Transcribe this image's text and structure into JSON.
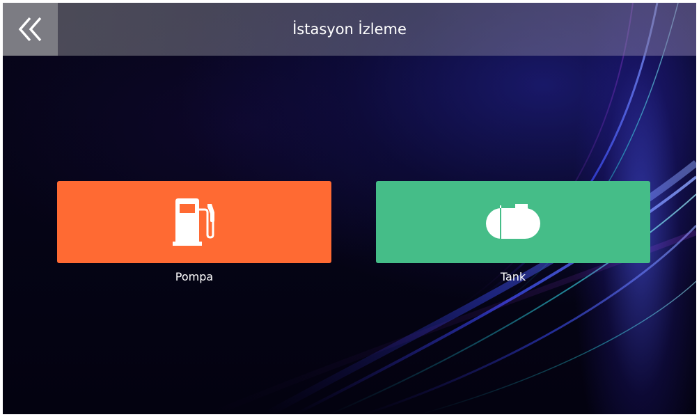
{
  "header": {
    "title": "İstasyon İzleme",
    "back_icon": "double-chevron-left-icon"
  },
  "tiles": [
    {
      "label": "Pompa",
      "icon": "fuel-pump-icon",
      "color": "#ff6a33"
    },
    {
      "label": "Tank",
      "icon": "fuel-tank-icon",
      "color": "#45bd88"
    }
  ],
  "colors": {
    "background": "#05041a",
    "header_overlay": "#7a7a82"
  }
}
